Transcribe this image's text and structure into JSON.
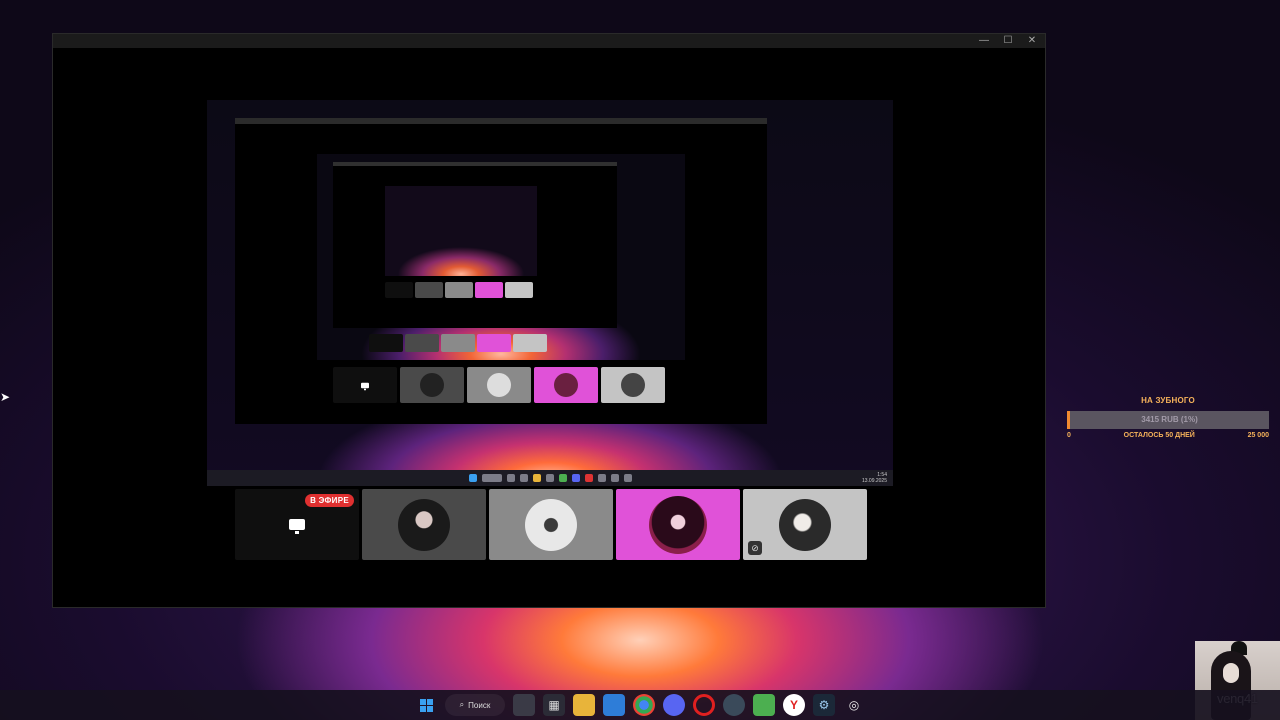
{
  "window": {
    "minimize": "—",
    "maximize": "☐",
    "close": "✕"
  },
  "tiles": [
    {
      "kind": "screen",
      "badge": "В ЭФИРЕ"
    },
    {
      "kind": "avatar",
      "style": "gray"
    },
    {
      "kind": "avatar",
      "style": "light"
    },
    {
      "kind": "avatar",
      "style": "pink"
    },
    {
      "kind": "avatar",
      "style": "silver",
      "muted": true
    }
  ],
  "donation": {
    "title": "НА ЗУБНОГО",
    "progress_text": "3415 RUB (1%)",
    "progress_fraction": 0.01,
    "min": "0",
    "remaining": "ОСТАЛОСЬ 50 ДНЕЙ",
    "max": "25 000"
  },
  "webcam": {
    "name": "venq41"
  },
  "taskbar": {
    "search_label": "Поиск"
  },
  "nested_share": {
    "time": "1:54",
    "date": "13.09.2025"
  },
  "colors": {
    "live_red": "#e03030",
    "donation_orange": "#f5b25a",
    "pink_tile": "#e052d8"
  }
}
